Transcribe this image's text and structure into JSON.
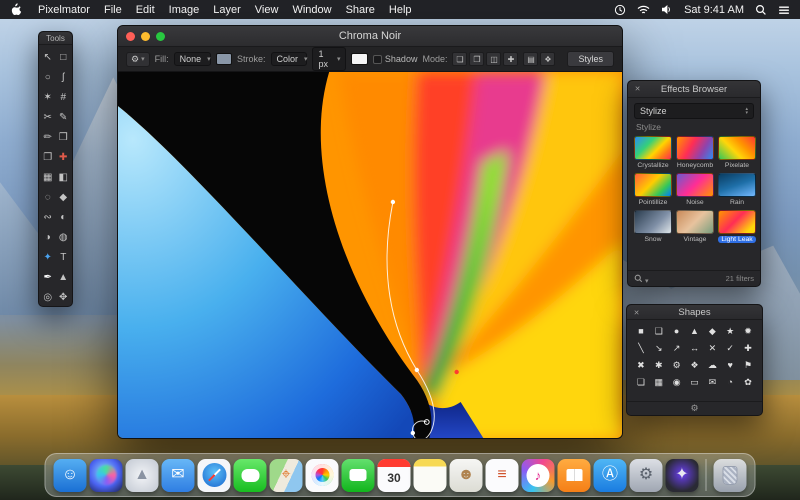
{
  "menu_bar": {
    "items": [
      {
        "name": "pixelmator",
        "label": "Pixelmator"
      },
      {
        "name": "file",
        "label": "File"
      },
      {
        "name": "edit",
        "label": "Edit"
      },
      {
        "name": "image",
        "label": "Image"
      },
      {
        "name": "layer",
        "label": "Layer"
      },
      {
        "name": "view",
        "label": "View"
      },
      {
        "name": "window",
        "label": "Window"
      },
      {
        "name": "share",
        "label": "Share"
      },
      {
        "name": "help",
        "label": "Help"
      }
    ],
    "time": "Sat 9:41 AM"
  },
  "tools_panel": {
    "title": "Tools",
    "tools": [
      {
        "name": "move",
        "glyph": "↖"
      },
      {
        "name": "marquee",
        "glyph": "□"
      },
      {
        "name": "elliptical-marquee",
        "glyph": "○"
      },
      {
        "name": "lasso",
        "glyph": "ʃ"
      },
      {
        "name": "magic-wand",
        "glyph": "✶"
      },
      {
        "name": "crop",
        "glyph": "#"
      },
      {
        "name": "slice",
        "glyph": "✂"
      },
      {
        "name": "pencil",
        "glyph": "✎"
      },
      {
        "name": "brush",
        "glyph": "✏"
      },
      {
        "name": "eraser",
        "glyph": "❒"
      },
      {
        "name": "clone-stamp",
        "glyph": "❐"
      },
      {
        "name": "healing",
        "glyph": "✚",
        "fg": "#e05a4a"
      },
      {
        "name": "gradient",
        "glyph": "▦"
      },
      {
        "name": "paint-bucket",
        "glyph": "◧"
      },
      {
        "name": "blur",
        "glyph": "◌"
      },
      {
        "name": "sharpen",
        "glyph": "◆"
      },
      {
        "name": "smudge",
        "glyph": "∾"
      },
      {
        "name": "dodge",
        "glyph": "◐"
      },
      {
        "name": "burn",
        "glyph": "◑"
      },
      {
        "name": "sponge",
        "glyph": "◍"
      },
      {
        "name": "eyedropper",
        "glyph": "✦",
        "fg": "#4aa3f0"
      },
      {
        "name": "type",
        "glyph": "T"
      },
      {
        "name": "pen",
        "glyph": "✒",
        "fg": "#ffffff"
      },
      {
        "name": "shape",
        "glyph": "▲"
      },
      {
        "name": "zoom",
        "glyph": "◎"
      },
      {
        "name": "hand",
        "glyph": "✥"
      }
    ]
  },
  "window": {
    "title": "Chroma Noir",
    "toolbar": {
      "settings_glyph": "⚙",
      "fill_label": "Fill:",
      "fill_value": "None",
      "fill_swatch": "#8a97a8",
      "stroke_label": "Stroke:",
      "stroke_value": "Color",
      "stroke_width": "1 px",
      "stroke_swatch": "#f5f5f5",
      "shadow_label": "Shadow",
      "mode_label": "Mode:",
      "mode_buttons": [
        {
          "name": "mode-union",
          "glyph": "❏"
        },
        {
          "name": "mode-subtract",
          "glyph": "❐"
        },
        {
          "name": "mode-intersect",
          "glyph": "◫"
        },
        {
          "name": "mode-exclude",
          "glyph": "✚"
        }
      ],
      "extra_buttons": [
        {
          "name": "arrange",
          "glyph": "▤"
        },
        {
          "name": "effects",
          "glyph": "❖"
        }
      ],
      "styles_label": "Styles"
    }
  },
  "effects_panel": {
    "title": "Effects Browser",
    "category": "Stylize",
    "section": "Stylize",
    "count": "21 filters",
    "effects": [
      {
        "name": "crystallize",
        "label": "Crystallize",
        "thumb": "linear-gradient(135deg,#2d8cf0,#35d07a 35%,#ffd400 60%,#ff7a18 80%,#ff2d55)"
      },
      {
        "name": "honeycomb",
        "label": "Honeycomb",
        "thumb": "linear-gradient(120deg,#ff9500,#ff2d55 40%,#8e44ad 70%,#2d8cf0)"
      },
      {
        "name": "pixelate",
        "label": "Pixelate",
        "thumb": "linear-gradient(45deg,#34c759,#ffd60a 40%,#ff9500 65%,#ff3b30)"
      },
      {
        "name": "pointillize",
        "label": "Pointillize",
        "thumb": "linear-gradient(135deg,#ff5e3a,#ffcc00 45%,#34c759 75%,#007aff)"
      },
      {
        "name": "noise",
        "label": "Noise",
        "thumb": "linear-gradient(135deg,#6a5acd,#ff2d95 50%,#ff9500)"
      },
      {
        "name": "rain",
        "label": "Rain",
        "thumb": "linear-gradient(160deg,#0a3d62,#1e6fa8 50%,#74b9ff)"
      },
      {
        "name": "snow",
        "label": "Snow",
        "thumb": "linear-gradient(135deg,#2c3e50,#7f8fa6 60%,#dfe6e9)"
      },
      {
        "name": "vintage",
        "label": "Vintage",
        "thumb": "linear-gradient(135deg,#c98a5a,#e8c39e 50%,#7a9e7e)"
      },
      {
        "name": "light-leak",
        "label": "Light Leak",
        "thumb": "linear-gradient(135deg,#ff9500,#ff2d55 45%,#ffd60a 85%)",
        "selected": true
      }
    ]
  },
  "shapes_panel": {
    "title": "Shapes",
    "shapes": [
      {
        "name": "square",
        "glyph": "■"
      },
      {
        "name": "rounded-square",
        "glyph": "❑"
      },
      {
        "name": "circle",
        "glyph": "●"
      },
      {
        "name": "triangle",
        "glyph": "▲"
      },
      {
        "name": "diamond",
        "glyph": "◆"
      },
      {
        "name": "star",
        "glyph": "★"
      },
      {
        "name": "burst",
        "glyph": "✹"
      },
      {
        "name": "line",
        "glyph": "╲"
      },
      {
        "name": "arrow-down-right",
        "glyph": "↘"
      },
      {
        "name": "arrow-up-right",
        "glyph": "↗"
      },
      {
        "name": "arrow-left-right",
        "glyph": "↔"
      },
      {
        "name": "cross",
        "glyph": "✕"
      },
      {
        "name": "check",
        "glyph": "✓"
      },
      {
        "name": "plus",
        "glyph": "✚"
      },
      {
        "name": "multiply",
        "glyph": "✖"
      },
      {
        "name": "asterisk",
        "glyph": "✱"
      },
      {
        "name": "gear",
        "glyph": "⚙"
      },
      {
        "name": "ornament",
        "glyph": "❖"
      },
      {
        "name": "cloud",
        "glyph": "☁"
      },
      {
        "name": "heart",
        "glyph": "♥"
      },
      {
        "name": "flag",
        "glyph": "⚑"
      },
      {
        "name": "document",
        "glyph": "❏"
      },
      {
        "name": "grid",
        "glyph": "▦"
      },
      {
        "name": "target",
        "glyph": "◉"
      },
      {
        "name": "display",
        "glyph": "▭"
      },
      {
        "name": "mail",
        "glyph": "✉"
      },
      {
        "name": "clock",
        "glyph": "◔"
      },
      {
        "name": "flower",
        "glyph": "✿"
      }
    ],
    "footer_glyph": "⚙"
  },
  "dock": {
    "items": [
      {
        "name": "finder",
        "kind": "glyph",
        "glyph": "☺",
        "fg": "#ffffff",
        "bg": "linear-gradient(180deg,#55aef2,#1a6fd4)"
      },
      {
        "name": "siri",
        "kind": "siri",
        "bg": "radial-gradient(circle at 45% 40%,#8fd6ff,#4a62f0 55%,#1a1f4a)"
      },
      {
        "name": "launchpad",
        "kind": "glyph",
        "glyph": "▲",
        "fg": "#8a93a2",
        "bg": "radial-gradient(circle,#f2f4f7,#c2c8d2)"
      },
      {
        "name": "mail",
        "kind": "glyph",
        "glyph": "✉",
        "fg": "#ffffff",
        "bg": "linear-gradient(180deg,#67b7f7,#2f7ee2)"
      },
      {
        "name": "safari",
        "kind": "safari",
        "bg": "#f4f6f9"
      },
      {
        "name": "messages",
        "kind": "bubble",
        "bg": "linear-gradient(180deg,#67e86a,#18bd20)"
      },
      {
        "name": "maps",
        "kind": "glyph",
        "glyph": "⌖",
        "fg": "#e0782a",
        "bg": "linear-gradient(115deg,#9fd98a 38%,#efeadd 38% 62%,#8fc7ef 62%)"
      },
      {
        "name": "photos",
        "kind": "photos",
        "bg": "#fafafc"
      },
      {
        "name": "facetime",
        "kind": "cam",
        "bg": "linear-gradient(180deg,#63e06e,#11b51c)"
      },
      {
        "name": "calendar",
        "kind": "calendar",
        "glyph": "30",
        "fg": "#333333",
        "bg": "#fbfbfd"
      },
      {
        "name": "notes",
        "kind": "glyph",
        "glyph": "",
        "bg": "linear-gradient(180deg,#f7d954 22%,#fbfbf6 22%)"
      },
      {
        "name": "contacts",
        "kind": "glyph",
        "glyph": "☻",
        "fg": "#b0834f",
        "bg": "linear-gradient(180deg,#f6f6f4,#dcdcd4)"
      },
      {
        "name": "reminders",
        "kind": "glyph",
        "glyph": "≡",
        "fg": "#d0542e",
        "bg": "#fbfbfd"
      },
      {
        "name": "itunes",
        "kind": "itunes",
        "glyph": "♪",
        "bg": "conic-gradient(from 200deg,#37c5f0,#8a5cf5,#f2478f,#f79a2e,#37c5f0)"
      },
      {
        "name": "ibooks",
        "kind": "book",
        "bg": "linear-gradient(180deg,#ffab40,#f57f17)"
      },
      {
        "name": "app-store",
        "kind": "glyph",
        "glyph": "Ⓐ",
        "fg": "#ffffff",
        "bg": "linear-gradient(180deg,#4fb6f5,#1a7ce0)"
      },
      {
        "name": "system-preferences",
        "kind": "glyph",
        "glyph": "⚙",
        "fg": "#5a616c",
        "bg": "linear-gradient(180deg,#dcdfe5,#9fa6b2)"
      },
      {
        "name": "pixelmator",
        "kind": "glyph",
        "glyph": "✦",
        "fg": "#e8e8f0",
        "bg": "radial-gradient(circle at 50% 45%,#6a3ff0 0%,#2a2a34 70%)"
      }
    ],
    "trash": {
      "name": "trash",
      "kind": "trash",
      "bg": "linear-gradient(180deg,rgba(235,238,245,.85),rgba(165,172,188,.85))"
    }
  }
}
